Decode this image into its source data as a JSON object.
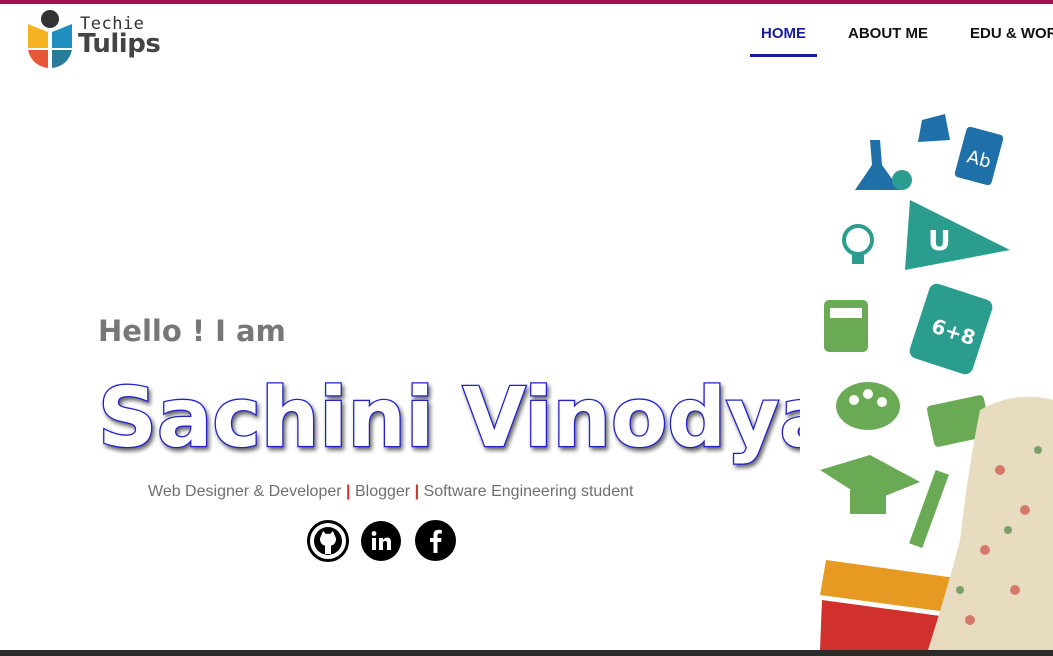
{
  "brand": {
    "small": "Techie",
    "big": "Tulips",
    "colors": {
      "yellow": "#f5b321",
      "blue": "#1f8fbf",
      "orange": "#e8563a",
      "teal": "#2a9d8f",
      "dark": "#333333"
    }
  },
  "nav": {
    "items": [
      {
        "label": "HOME",
        "active": true
      },
      {
        "label": "ABOUT ME",
        "active": false
      },
      {
        "label": "EDU & WORK",
        "active": false
      }
    ]
  },
  "hero": {
    "greeting": "Hello ! I am",
    "name": "Sachini Vinodya",
    "roles": [
      "Web Designer & Developer",
      "Blogger",
      "Software Engineering student"
    ],
    "separator": "|",
    "social": [
      {
        "icon": "github-icon"
      },
      {
        "icon": "linkedin-icon"
      },
      {
        "icon": "facebook-icon"
      }
    ]
  },
  "colors": {
    "accent": "#1a1aa0",
    "topbar": "#a0154f",
    "separator": "#d0312d",
    "name_outline": "#2222cc"
  }
}
